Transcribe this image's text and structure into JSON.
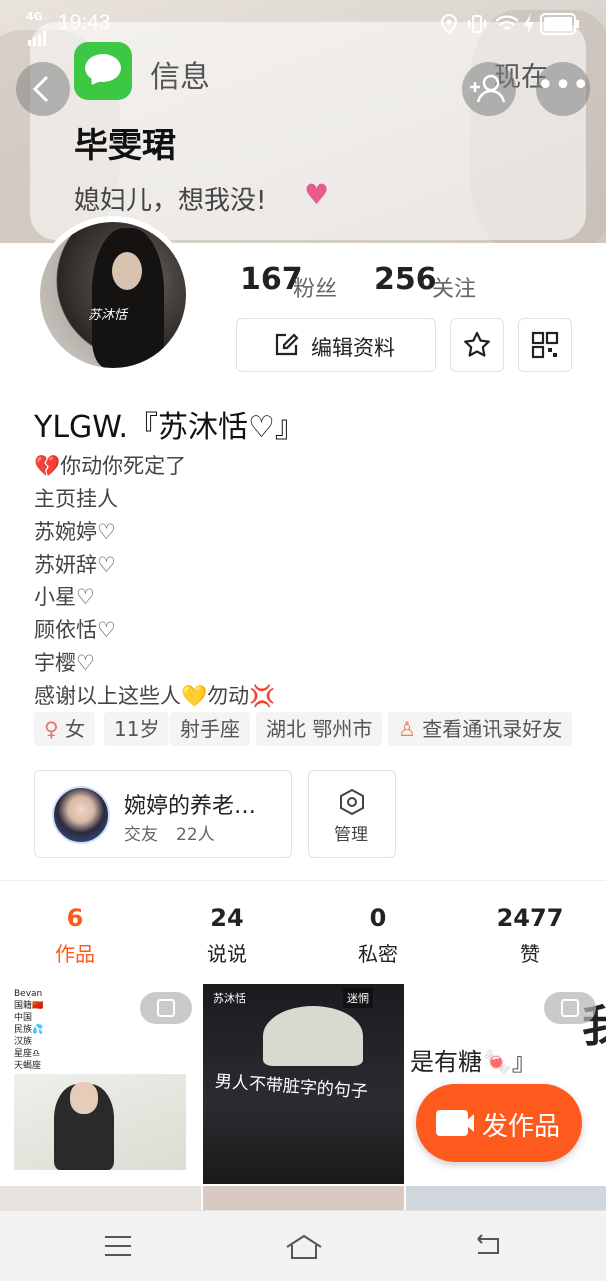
{
  "status_bar": {
    "network": "4G",
    "time": "19:43"
  },
  "notification": {
    "app_name": "信息",
    "time": "现在",
    "sender": "毕雯珺",
    "message": "媳妇儿，想我没!",
    "heart": "♥"
  },
  "header_buttons": {
    "back": "‹",
    "more": "•••"
  },
  "avatar": {
    "watermark": "苏沐恬"
  },
  "stats": {
    "fans_count": "167",
    "fans_label": "粉丝",
    "following_count": "256",
    "following_label": "关注"
  },
  "actions": {
    "edit_profile": "编辑资料"
  },
  "profile": {
    "nickname": "YLGW.『苏沐恬♡』",
    "bio": [
      "💔你动你死定了",
      "主页挂人",
      "苏婉婷♡",
      "苏妍辞♡",
      "小星♡",
      "顾依恬♡",
      "宇樱♡",
      "感谢以上这些人💛勿动💢"
    ]
  },
  "tags": {
    "gender": "女",
    "age": "11岁",
    "zodiac": "射手座",
    "location": "湖北 鄂州市",
    "contacts": "查看通讯录好友"
  },
  "group": {
    "name": "婉婷的养老…",
    "type": "交友",
    "members": "22人"
  },
  "manage": {
    "label": "管理"
  },
  "tabs": [
    {
      "count": "6",
      "label": "作品"
    },
    {
      "count": "24",
      "label": "说说"
    },
    {
      "count": "0",
      "label": "私密"
    },
    {
      "count": "2477",
      "label": "赞"
    }
  ],
  "grid": {
    "cell1_list": [
      "Bevan",
      "国籍🇨🇳",
      "中国",
      "民族💦",
      "汉族",
      "星座♎",
      "天蝎座"
    ],
    "cell2_caption": "男人不带脏字的句子",
    "cell2_watermark": "苏沐恬",
    "cell2_logo": "迷惘",
    "cell3_text": "是有糖🍬』",
    "cell3_big": "我"
  },
  "post_button": {
    "label": "发作品"
  },
  "colors": {
    "accent": "#ff5a1e",
    "tab_active": "#ff5a1e"
  }
}
